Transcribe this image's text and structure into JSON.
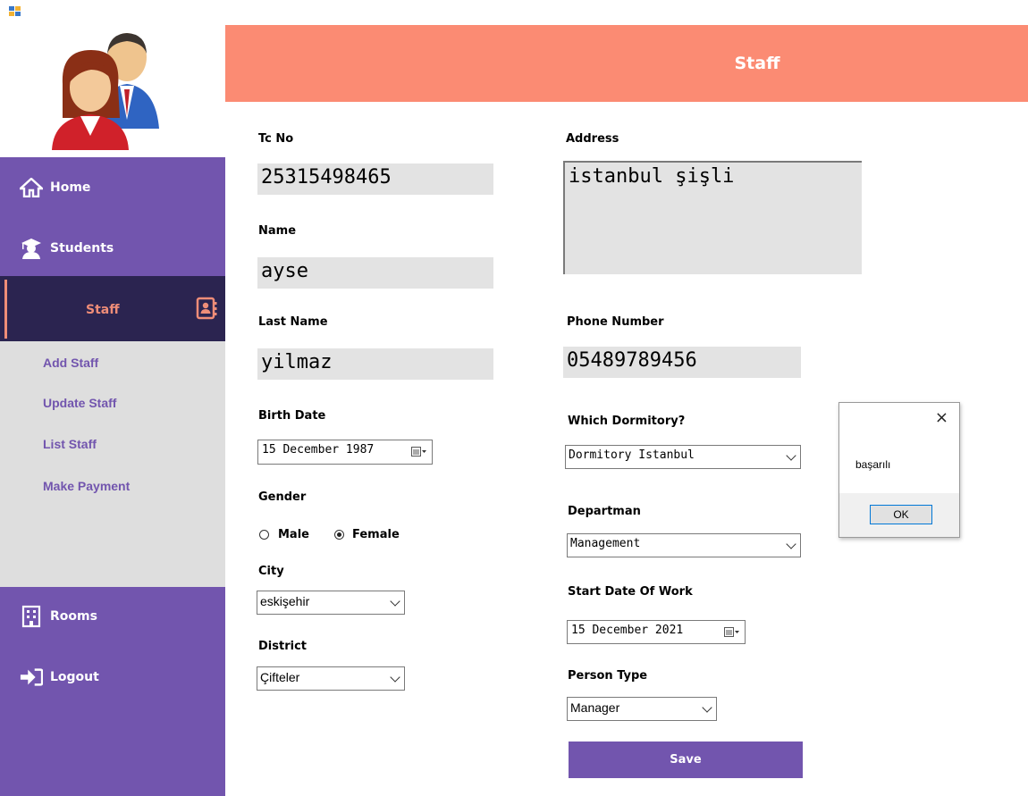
{
  "header": {
    "title": "Staff"
  },
  "sidebar": {
    "items": [
      {
        "label": "Home",
        "icon": "home-icon"
      },
      {
        "label": "Students",
        "icon": "graduate-icon"
      },
      {
        "label": "Staff",
        "icon": "contact-book-icon"
      },
      {
        "label": "Rooms",
        "icon": "building-icon"
      },
      {
        "label": "Logout",
        "icon": "logout-icon"
      }
    ],
    "sub_items": [
      "Add Staff",
      "Update Staff",
      "List Staff",
      "Make Payment"
    ]
  },
  "form": {
    "tc_no": {
      "label": "Tc No",
      "value": "25315498465"
    },
    "name": {
      "label": "Name",
      "value": "ayse"
    },
    "last_name": {
      "label": "Last Name",
      "value": "yilmaz"
    },
    "birth_date": {
      "label": "Birth Date",
      "value": "15 December 1987"
    },
    "gender": {
      "label": "Gender",
      "options": [
        "Male",
        "Female"
      ],
      "selected": "Female"
    },
    "city": {
      "label": "City",
      "value": "eskişehir"
    },
    "district": {
      "label": "District",
      "value": "Çifteler"
    },
    "address": {
      "label": "Address",
      "value": "istanbul şişli"
    },
    "phone": {
      "label": "Phone Number",
      "value": "05489789456"
    },
    "dormitory": {
      "label": "Which Dormitory?",
      "value": "Dormitory Istanbul"
    },
    "department": {
      "label": "Departman",
      "value": "Management"
    },
    "start_date": {
      "label": "Start Date Of Work",
      "value": "15 December 2021"
    },
    "person_type": {
      "label": "Person Type",
      "value": "Manager"
    },
    "save_label": "Save"
  },
  "dialog": {
    "message": "başarılı",
    "ok_label": "OK",
    "close_glyph": "×"
  },
  "colors": {
    "accent": "#7255ae",
    "header": "#fb8b73",
    "sidebar_dark": "#2b2450",
    "submenu_bg": "#dedede",
    "field_bg": "#e3e3e3"
  }
}
